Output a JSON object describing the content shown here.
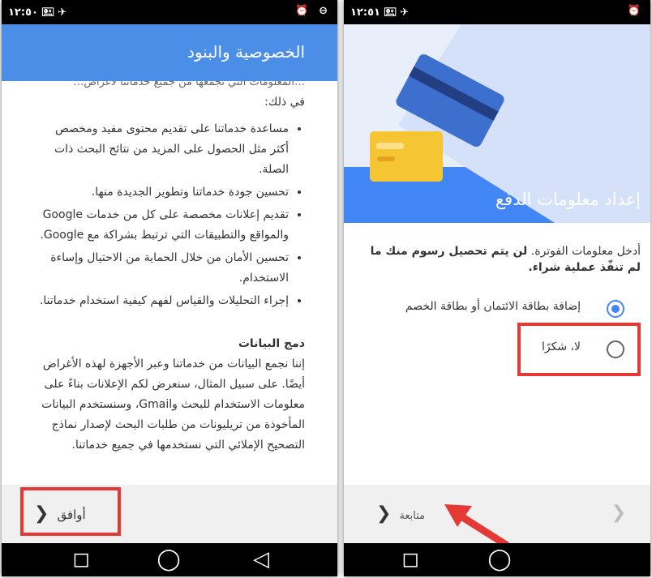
{
  "left": {
    "status": {
      "time": "١٢:٥٠",
      "icons_left": "🖭 ✈",
      "icons_right": "⏰ ⊖"
    },
    "appbar_title": "الخصوصية والبنود",
    "cut_line": "…المعلومات التي نجمعها من جميع خدماتنا لأغراض…",
    "intro": "في ذلك:",
    "bullets": [
      "مساعدة خدماتنا على تقديم محتوى مفيد ومخصص أكثر مثل الحصول على المزيد من نتائج البحث ذات الصلة.",
      "تحسين جودة خدماتنا وتطوير الجديدة منها.",
      "تقديم إعلانات مخصصة على كل من خدمات Google والمواقع والتطبيقات التي ترتبط بشراكة مع Google.",
      "تحسين الأمان من خلال الحماية من الاحتيال وإساءة الاستخدام.",
      "إجراء التحليلات والقياس لفهم كيفية استخدام خدماتنا."
    ],
    "section_title": "دمج البيانات",
    "section_body": "إننا نجمع البيانات من خدماتنا وعبر الأجهزة لهذه الأغراض أيضًا. على سبيل المثال، سنعرض لكم الإعلانات بناءً على معلومات الاستخدام للبحث وGmail، وسنستخدم البيانات المأخوذة من تريليونات من طلبات البحث لإصدار نماذج التصحيح الإملائي التي نستخدمها في جميع خدماتنا.",
    "agree_label": "أوافق",
    "chevron": "❮",
    "nav": {
      "square": "◻",
      "home": "◯",
      "back": "◁"
    }
  },
  "right": {
    "status": {
      "time": "١٢:٥١",
      "icons_left": "🖭 ✈",
      "icons_right": "⏰"
    },
    "title": "إعداد معلومات الدفع",
    "desc_plain": "أدخل معلومات الفوترة. ",
    "desc_bold": "لن يتم تحصيل رسوم منك ما لم تنفّذ عملية شراء.",
    "options": [
      {
        "label": "إضافة بطاقة الائتمان أو بطاقة الخصم",
        "selected": true
      },
      {
        "label": "لا، شكرًا",
        "selected": false
      }
    ],
    "next_label": "متابعة",
    "chevron": "❮",
    "next_disabled": "❯",
    "nav": {
      "square": "◻",
      "home": "◯"
    }
  },
  "colors": {
    "accent": "#4285f4",
    "highlight": "#e53935",
    "appbar": "#4a8ee8"
  }
}
